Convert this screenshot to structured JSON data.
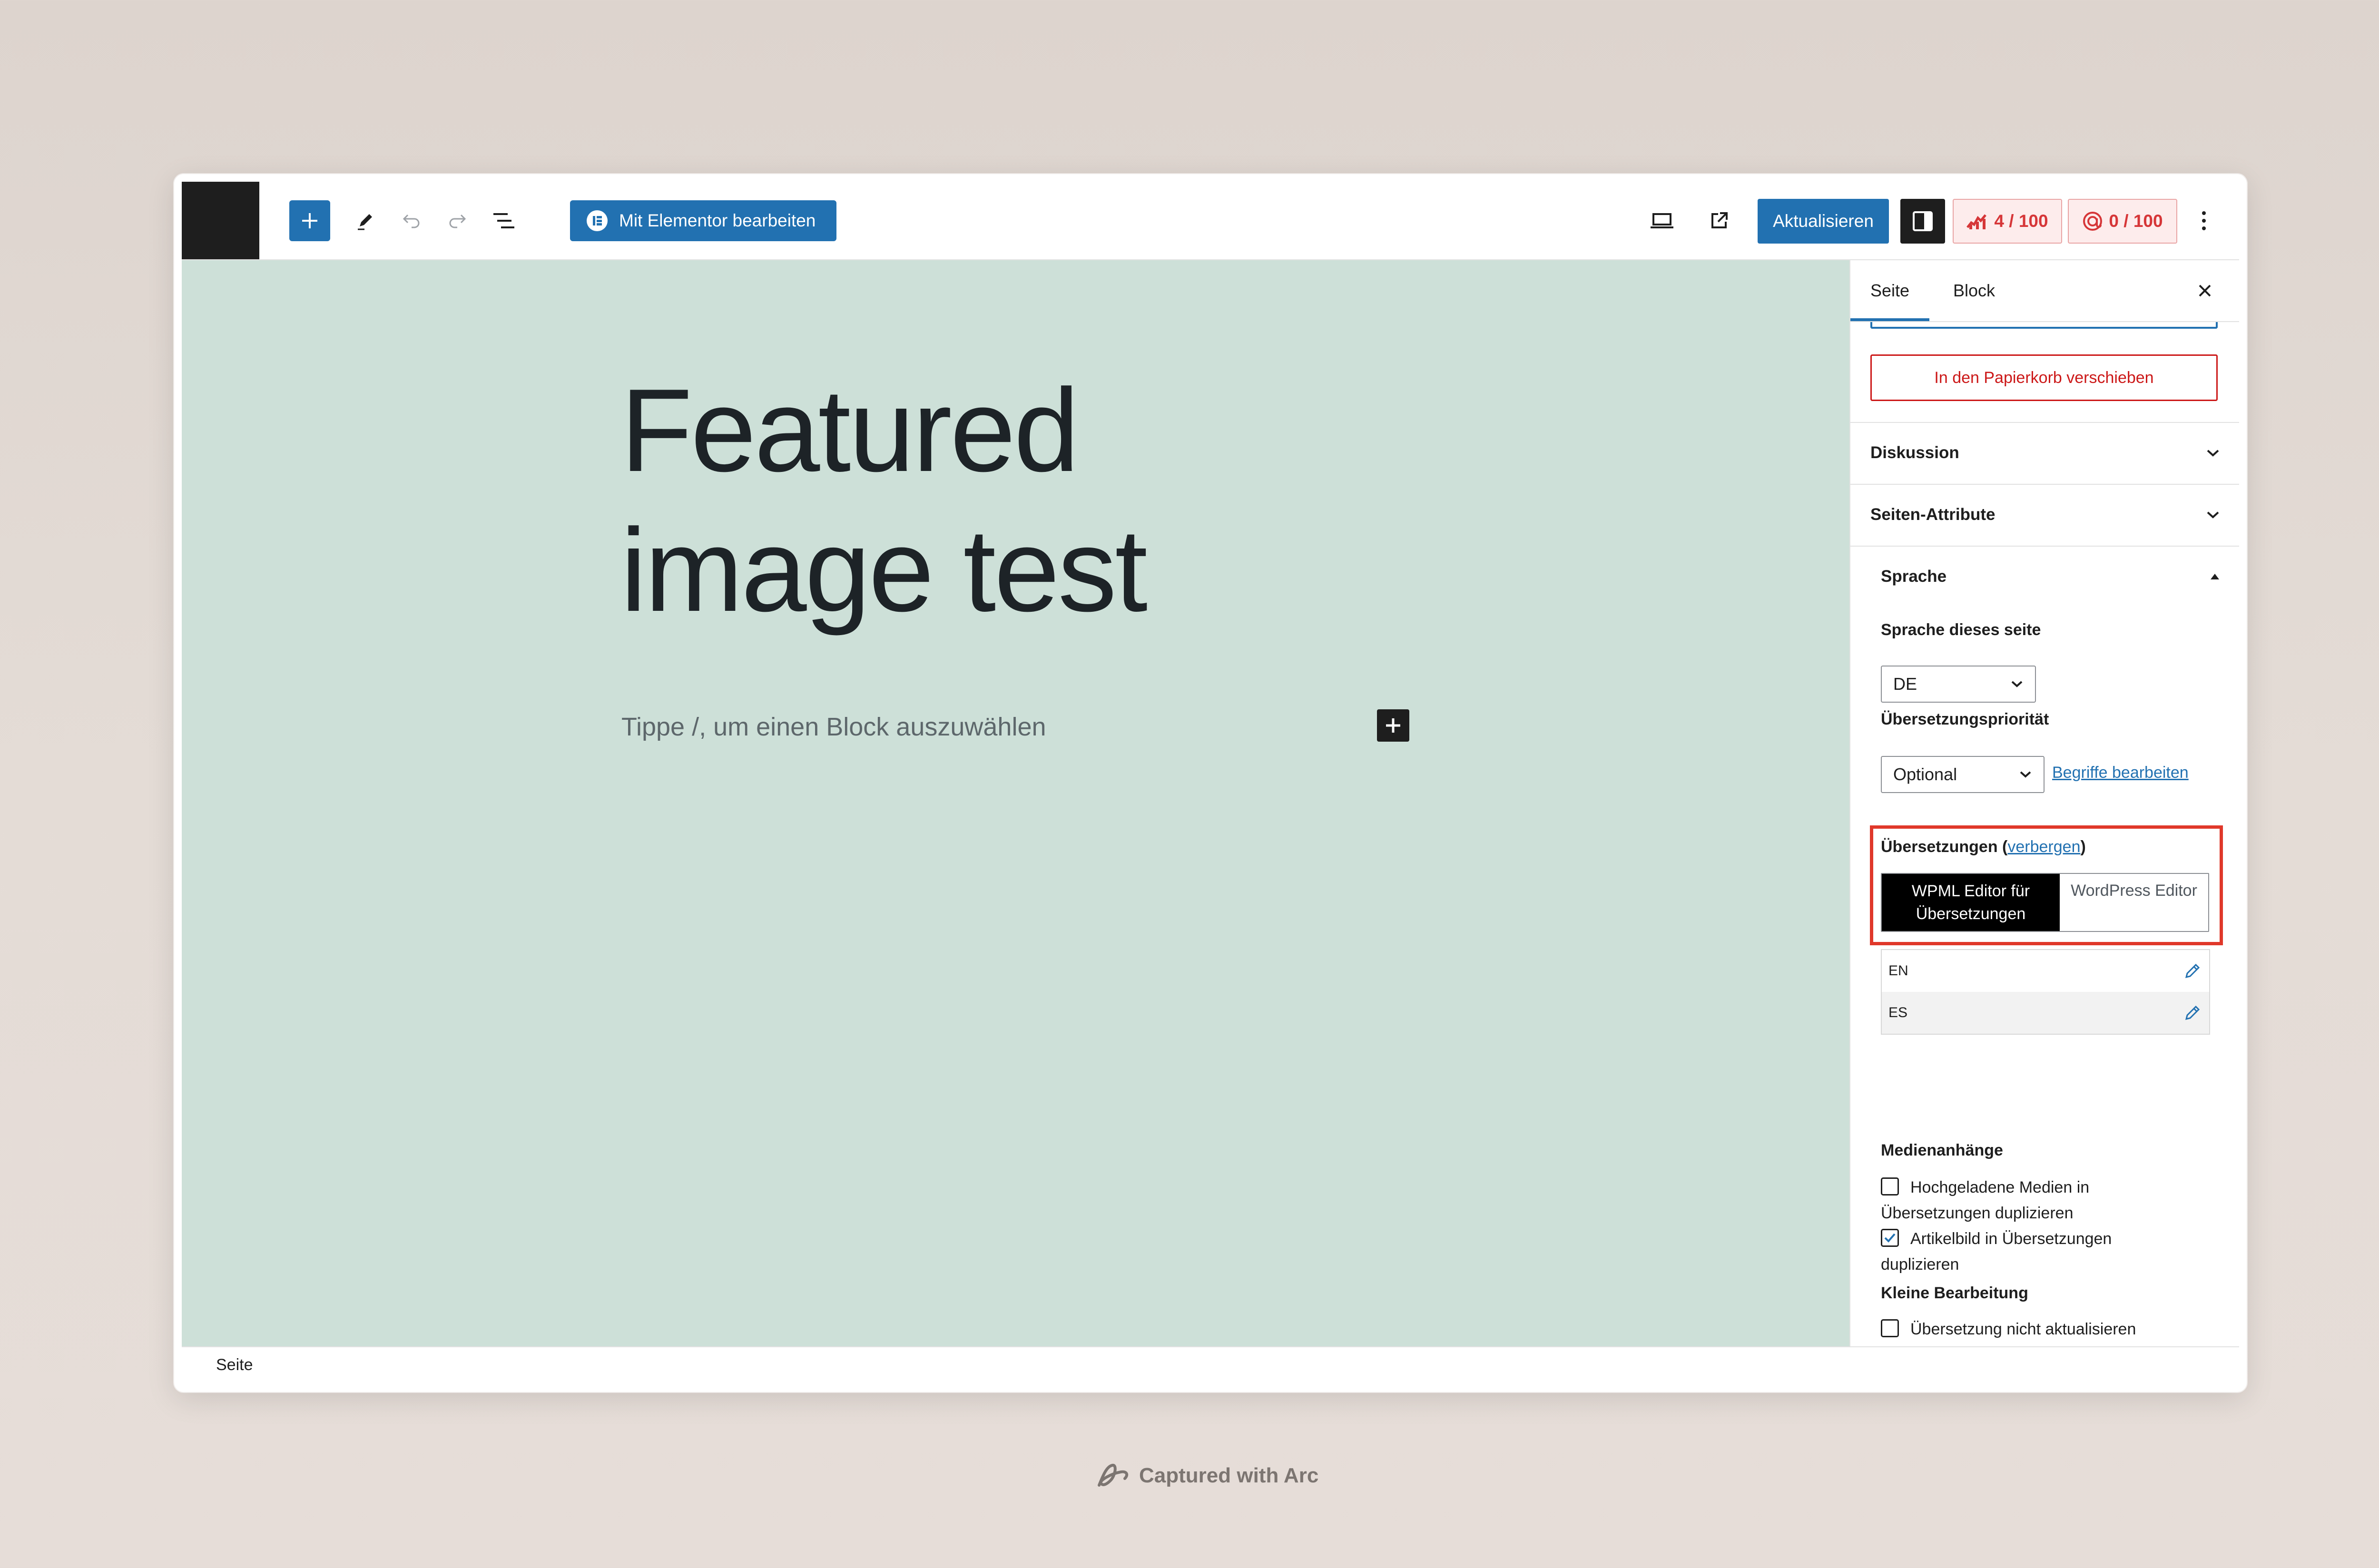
{
  "toolbar": {
    "elementor_label": "Mit Elementor bearbeiten",
    "update_label": "Aktualisieren",
    "seo_score": "4 / 100",
    "readability_score": "0 / 100"
  },
  "canvas": {
    "title_line1": "Featured",
    "title_line2": "image test",
    "block_placeholder": "Tippe /, um einen Block auszuwählen"
  },
  "sidebar": {
    "tab_page": "Seite",
    "tab_block": "Block",
    "trash_label": "In den Papierkorb verschieben",
    "discussion": "Diskussion",
    "page_attributes": "Seiten-Attribute",
    "language": "Sprache",
    "page_language_label": "Sprache dieses seite",
    "page_language_value": "DE",
    "priority_label": "Übersetzungspriorität",
    "priority_value": "Optional",
    "edit_terms": "Begriffe bearbeiten",
    "translations_label": "Übersetzungen",
    "hide_link": "verbergen",
    "wpml_editor_line1": "WPML Editor für",
    "wpml_editor_line2": "Übersetzungen",
    "wp_editor": "WordPress Editor",
    "languages": [
      "EN",
      "ES"
    ],
    "media_label": "Medienanhänge",
    "dup_media_line1": "Hochgeladene Medien in",
    "dup_media_line2": "Übersetzungen duplizieren",
    "dup_media_checked": false,
    "dup_featured_line1": "Artikelbild in Übersetzungen",
    "dup_featured_line2": "duplizieren",
    "dup_featured_checked": true,
    "minor_edit_label": "Kleine Bearbeitung",
    "no_update_label": "Übersetzung nicht aktualisieren",
    "no_update_checked": false
  },
  "statusbar": {
    "breadcrumb": "Seite"
  },
  "footer": {
    "credit": "Captured with Arc"
  },
  "colors": {
    "accent": "#2271b1",
    "canvas_bg": "#cde0d8",
    "danger": "#cc1818",
    "highlight": "#e0382a",
    "seo_badge": "#d63638"
  }
}
